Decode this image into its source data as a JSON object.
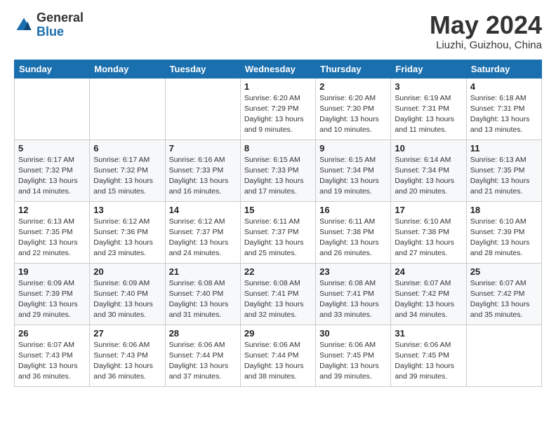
{
  "header": {
    "logo_general": "General",
    "logo_blue": "Blue",
    "title": "May 2024",
    "location": "Liuzhi, Guizhou, China"
  },
  "weekdays": [
    "Sunday",
    "Monday",
    "Tuesday",
    "Wednesday",
    "Thursday",
    "Friday",
    "Saturday"
  ],
  "weeks": [
    [
      {
        "day": "",
        "sunrise": "",
        "sunset": "",
        "daylight": ""
      },
      {
        "day": "",
        "sunrise": "",
        "sunset": "",
        "daylight": ""
      },
      {
        "day": "",
        "sunrise": "",
        "sunset": "",
        "daylight": ""
      },
      {
        "day": "1",
        "sunrise": "Sunrise: 6:20 AM",
        "sunset": "Sunset: 7:29 PM",
        "daylight": "Daylight: 13 hours and 9 minutes."
      },
      {
        "day": "2",
        "sunrise": "Sunrise: 6:20 AM",
        "sunset": "Sunset: 7:30 PM",
        "daylight": "Daylight: 13 hours and 10 minutes."
      },
      {
        "day": "3",
        "sunrise": "Sunrise: 6:19 AM",
        "sunset": "Sunset: 7:31 PM",
        "daylight": "Daylight: 13 hours and 11 minutes."
      },
      {
        "day": "4",
        "sunrise": "Sunrise: 6:18 AM",
        "sunset": "Sunset: 7:31 PM",
        "daylight": "Daylight: 13 hours and 13 minutes."
      }
    ],
    [
      {
        "day": "5",
        "sunrise": "Sunrise: 6:17 AM",
        "sunset": "Sunset: 7:32 PM",
        "daylight": "Daylight: 13 hours and 14 minutes."
      },
      {
        "day": "6",
        "sunrise": "Sunrise: 6:17 AM",
        "sunset": "Sunset: 7:32 PM",
        "daylight": "Daylight: 13 hours and 15 minutes."
      },
      {
        "day": "7",
        "sunrise": "Sunrise: 6:16 AM",
        "sunset": "Sunset: 7:33 PM",
        "daylight": "Daylight: 13 hours and 16 minutes."
      },
      {
        "day": "8",
        "sunrise": "Sunrise: 6:15 AM",
        "sunset": "Sunset: 7:33 PM",
        "daylight": "Daylight: 13 hours and 17 minutes."
      },
      {
        "day": "9",
        "sunrise": "Sunrise: 6:15 AM",
        "sunset": "Sunset: 7:34 PM",
        "daylight": "Daylight: 13 hours and 19 minutes."
      },
      {
        "day": "10",
        "sunrise": "Sunrise: 6:14 AM",
        "sunset": "Sunset: 7:34 PM",
        "daylight": "Daylight: 13 hours and 20 minutes."
      },
      {
        "day": "11",
        "sunrise": "Sunrise: 6:13 AM",
        "sunset": "Sunset: 7:35 PM",
        "daylight": "Daylight: 13 hours and 21 minutes."
      }
    ],
    [
      {
        "day": "12",
        "sunrise": "Sunrise: 6:13 AM",
        "sunset": "Sunset: 7:35 PM",
        "daylight": "Daylight: 13 hours and 22 minutes."
      },
      {
        "day": "13",
        "sunrise": "Sunrise: 6:12 AM",
        "sunset": "Sunset: 7:36 PM",
        "daylight": "Daylight: 13 hours and 23 minutes."
      },
      {
        "day": "14",
        "sunrise": "Sunrise: 6:12 AM",
        "sunset": "Sunset: 7:37 PM",
        "daylight": "Daylight: 13 hours and 24 minutes."
      },
      {
        "day": "15",
        "sunrise": "Sunrise: 6:11 AM",
        "sunset": "Sunset: 7:37 PM",
        "daylight": "Daylight: 13 hours and 25 minutes."
      },
      {
        "day": "16",
        "sunrise": "Sunrise: 6:11 AM",
        "sunset": "Sunset: 7:38 PM",
        "daylight": "Daylight: 13 hours and 26 minutes."
      },
      {
        "day": "17",
        "sunrise": "Sunrise: 6:10 AM",
        "sunset": "Sunset: 7:38 PM",
        "daylight": "Daylight: 13 hours and 27 minutes."
      },
      {
        "day": "18",
        "sunrise": "Sunrise: 6:10 AM",
        "sunset": "Sunset: 7:39 PM",
        "daylight": "Daylight: 13 hours and 28 minutes."
      }
    ],
    [
      {
        "day": "19",
        "sunrise": "Sunrise: 6:09 AM",
        "sunset": "Sunset: 7:39 PM",
        "daylight": "Daylight: 13 hours and 29 minutes."
      },
      {
        "day": "20",
        "sunrise": "Sunrise: 6:09 AM",
        "sunset": "Sunset: 7:40 PM",
        "daylight": "Daylight: 13 hours and 30 minutes."
      },
      {
        "day": "21",
        "sunrise": "Sunrise: 6:08 AM",
        "sunset": "Sunset: 7:40 PM",
        "daylight": "Daylight: 13 hours and 31 minutes."
      },
      {
        "day": "22",
        "sunrise": "Sunrise: 6:08 AM",
        "sunset": "Sunset: 7:41 PM",
        "daylight": "Daylight: 13 hours and 32 minutes."
      },
      {
        "day": "23",
        "sunrise": "Sunrise: 6:08 AM",
        "sunset": "Sunset: 7:41 PM",
        "daylight": "Daylight: 13 hours and 33 minutes."
      },
      {
        "day": "24",
        "sunrise": "Sunrise: 6:07 AM",
        "sunset": "Sunset: 7:42 PM",
        "daylight": "Daylight: 13 hours and 34 minutes."
      },
      {
        "day": "25",
        "sunrise": "Sunrise: 6:07 AM",
        "sunset": "Sunset: 7:42 PM",
        "daylight": "Daylight: 13 hours and 35 minutes."
      }
    ],
    [
      {
        "day": "26",
        "sunrise": "Sunrise: 6:07 AM",
        "sunset": "Sunset: 7:43 PM",
        "daylight": "Daylight: 13 hours and 36 minutes."
      },
      {
        "day": "27",
        "sunrise": "Sunrise: 6:06 AM",
        "sunset": "Sunset: 7:43 PM",
        "daylight": "Daylight: 13 hours and 36 minutes."
      },
      {
        "day": "28",
        "sunrise": "Sunrise: 6:06 AM",
        "sunset": "Sunset: 7:44 PM",
        "daylight": "Daylight: 13 hours and 37 minutes."
      },
      {
        "day": "29",
        "sunrise": "Sunrise: 6:06 AM",
        "sunset": "Sunset: 7:44 PM",
        "daylight": "Daylight: 13 hours and 38 minutes."
      },
      {
        "day": "30",
        "sunrise": "Sunrise: 6:06 AM",
        "sunset": "Sunset: 7:45 PM",
        "daylight": "Daylight: 13 hours and 39 minutes."
      },
      {
        "day": "31",
        "sunrise": "Sunrise: 6:06 AM",
        "sunset": "Sunset: 7:45 PM",
        "daylight": "Daylight: 13 hours and 39 minutes."
      },
      {
        "day": "",
        "sunrise": "",
        "sunset": "",
        "daylight": ""
      }
    ]
  ]
}
